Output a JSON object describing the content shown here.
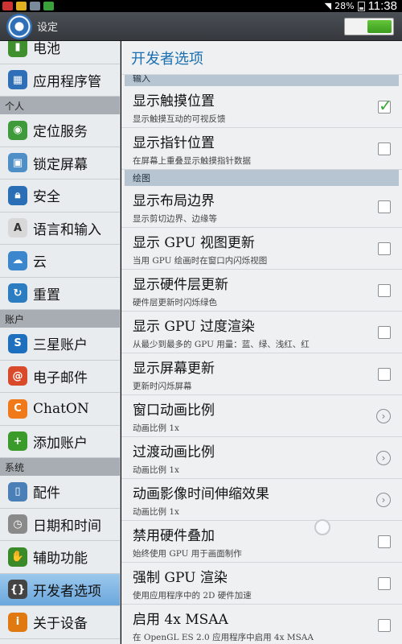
{
  "status_bar": {
    "battery": "28%",
    "time": "11:38",
    "icons": [
      "notification-icon",
      "warning-icon",
      "image-icon",
      "help-icon",
      "wifi-icon",
      "battery-icon"
    ]
  },
  "action_bar": {
    "title": "设定",
    "icon": "gear-icon",
    "toggle_on": true,
    "accent": "#4caf2f"
  },
  "sidebar": {
    "sections": [
      {
        "header": "",
        "items": [
          {
            "label": "电池",
            "icon": "battery-icon",
            "color": "#3f8f2f"
          },
          {
            "label": "应用程序管",
            "icon": "apps-icon",
            "color": "#2f6fb8"
          }
        ]
      },
      {
        "header": "个人",
        "items": [
          {
            "label": "定位服务",
            "icon": "location-icon",
            "color": "#3e9a3a"
          },
          {
            "label": "锁定屏幕",
            "icon": "lock-screen-icon",
            "color": "#4e8fc8"
          },
          {
            "label": "安全",
            "icon": "lock-icon",
            "color": "#2a6fb5"
          },
          {
            "label": "语言和输入",
            "icon": "keyboard-icon",
            "color": "#d8d8d8"
          },
          {
            "label": "云",
            "icon": "cloud-icon",
            "color": "#3b86cc"
          },
          {
            "label": "重置",
            "icon": "reset-icon",
            "color": "#2c7cc2"
          }
        ]
      },
      {
        "header": "账户",
        "items": [
          {
            "label": "三星账户",
            "icon": "samsung-account-icon",
            "color": "#1f6fbf"
          },
          {
            "label": "电子邮件",
            "icon": "email-icon",
            "color": "#d94a2a"
          },
          {
            "label": "ChatON",
            "icon": "chaton-icon",
            "color": "#f07a1a"
          },
          {
            "label": "添加账户",
            "icon": "add-account-icon",
            "color": "#3a9a2a"
          }
        ]
      },
      {
        "header": "系统",
        "items": [
          {
            "label": "配件",
            "icon": "accessory-icon",
            "color": "#4a7fb8"
          },
          {
            "label": "日期和时间",
            "icon": "clock-icon",
            "color": "#8a8a8a"
          },
          {
            "label": "辅助功能",
            "icon": "accessibility-icon",
            "color": "#3a8a2a"
          },
          {
            "label": "开发者选项",
            "icon": "developer-icon",
            "color": "#444444",
            "active": true
          },
          {
            "label": "关于设备",
            "icon": "info-icon",
            "color": "#e07a10"
          }
        ]
      }
    ]
  },
  "content": {
    "title": "开发者选项",
    "categories": [
      {
        "name": "输入",
        "items": [
          {
            "title": "显示触摸位置",
            "subtitle": "显示触摸互动的可视反馈",
            "control": "checkbox",
            "checked": true
          },
          {
            "title": "显示指针位置",
            "subtitle": "在屏幕上重叠显示触摸指针数据",
            "control": "checkbox",
            "checked": false
          }
        ]
      },
      {
        "name": "绘图",
        "items": [
          {
            "title": "显示布局边界",
            "subtitle": "显示剪切边界、边缘等",
            "control": "checkbox",
            "checked": false
          },
          {
            "title": "显示 GPU 视图更新",
            "subtitle": "当用 GPU 绘画时在窗口内闪烁视图",
            "control": "checkbox",
            "checked": false
          },
          {
            "title": "显示硬件层更新",
            "subtitle": "硬件层更新时闪烁绿色",
            "control": "checkbox",
            "checked": false
          },
          {
            "title": "显示 GPU 过度渲染",
            "subtitle": "从最少到最多的 GPU 用量：蓝、绿、浅红、红",
            "control": "checkbox",
            "checked": false
          },
          {
            "title": "显示屏幕更新",
            "subtitle": "更新时闪烁屏幕",
            "control": "checkbox",
            "checked": false
          },
          {
            "title": "窗口动画比例",
            "subtitle": "动画比例 1x",
            "control": "chevron"
          },
          {
            "title": "过渡动画比例",
            "subtitle": "动画比例 1x",
            "control": "chevron"
          },
          {
            "title": "动画影像时间伸缩效果",
            "subtitle": "动画比例 1x",
            "control": "chevron"
          },
          {
            "title": "禁用硬件叠加",
            "subtitle": "始终使用 GPU 用于画面制作",
            "control": "checkbox",
            "checked": false,
            "touch_indicator": true
          },
          {
            "title": "强制 GPU 渲染",
            "subtitle": "使用应用程序中的 2D 硬件加速",
            "control": "checkbox",
            "checked": false
          },
          {
            "title": "启用 4x MSAA",
            "subtitle": "在 OpenGL ES 2.0 应用程序中启用 4x MSAA",
            "control": "checkbox",
            "checked": false
          }
        ]
      }
    ]
  }
}
